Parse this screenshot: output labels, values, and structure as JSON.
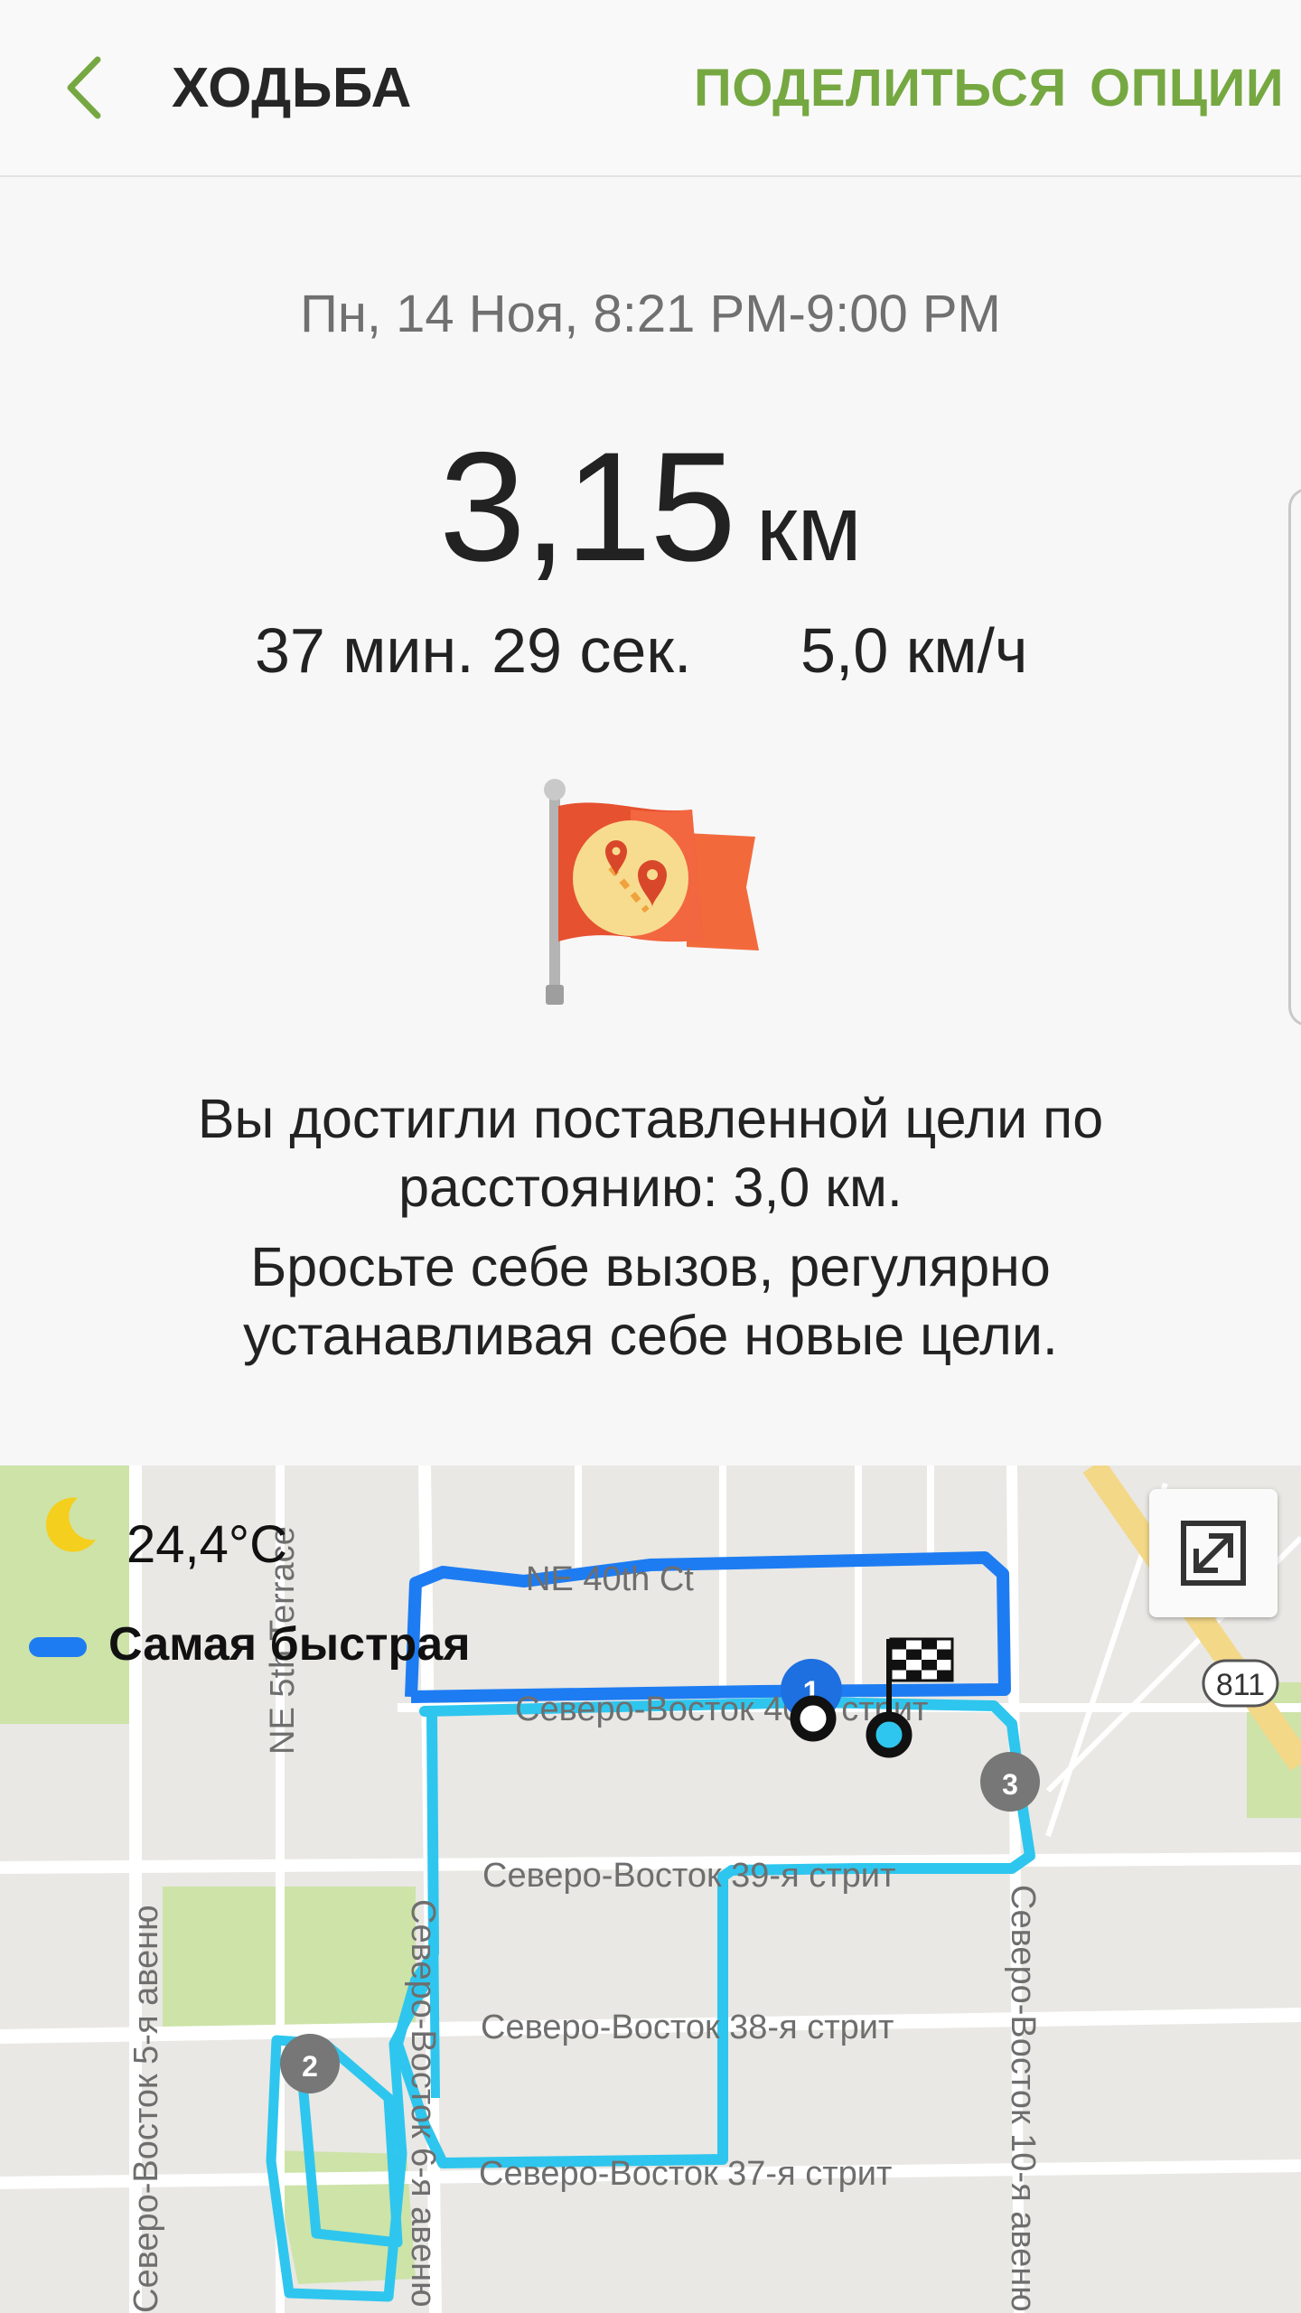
{
  "header": {
    "title": "ХОДЬБА",
    "share_label": "ПОДЕЛИТЬСЯ",
    "options_label": "ОПЦИИ"
  },
  "workout": {
    "date_range": "Пн, 14 Ноя, 8:21 PM-9:00 PM",
    "distance_value": "3,15",
    "distance_unit": "км",
    "duration": "37 мин. 29 сек.",
    "speed": "5,0 км/ч"
  },
  "goal": {
    "icon": "goal-flag-icon",
    "message_line1": "Вы достигли поставленной цели по расстоянию: 3,0 км.",
    "message_line2": "Бросьте себе вызов, регулярно устанавливая себе новые цели."
  },
  "map": {
    "weather_icon": "moon-icon",
    "temperature": "24,4°C",
    "legend_label": "Самая быстрая",
    "legend_color": "#1e7cf2",
    "route_color": "#2ec6ee",
    "streets": {
      "ne40": "NE 40th Ct",
      "ne5terrace": "NE 5th Terrace",
      "ne40street": "Северо-Восток 40-я стрит",
      "ne39": "Северо-Восток 39-я стрит",
      "ne38": "Северо-Восток 38-я стрит",
      "ne37": "Северо-Восток 37-я стрит",
      "ne5ave": "Северо-Восток 5-я авеню",
      "ne6ave": "Северо-Восток 6-я авеню",
      "ne10ave": "Северо-Восток 10-я авеню"
    },
    "route_shield": "811",
    "markers": [
      "1",
      "2",
      "3"
    ]
  }
}
